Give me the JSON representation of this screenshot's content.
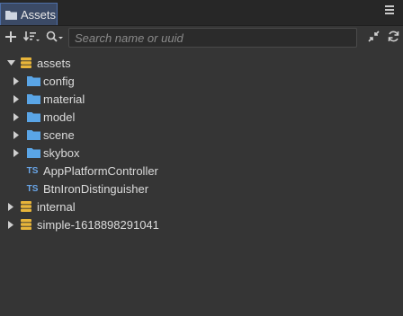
{
  "tab": {
    "title": "Assets",
    "icon": "folder-icon"
  },
  "toolbar": {
    "add_icon": "plus-icon",
    "sort_icon": "sort-icon",
    "search_filter_icon": "search-filter-icon",
    "search_placeholder": "Search name or uuid",
    "collapse_icon": "collapse-icon",
    "refresh_icon": "refresh-icon"
  },
  "tree": {
    "assets": {
      "label": "assets",
      "expanded": true
    },
    "config": {
      "label": "config"
    },
    "material": {
      "label": "material"
    },
    "model": {
      "label": "model"
    },
    "scene": {
      "label": "scene"
    },
    "skybox": {
      "label": "skybox"
    },
    "script1": {
      "label": "AppPlatformController",
      "badge": "TS"
    },
    "script2": {
      "label": "BtnIronDistinguisher",
      "badge": "TS"
    },
    "internal": {
      "label": "internal",
      "expanded": false
    },
    "simple": {
      "label": "simple-1618898291041",
      "expanded": false
    }
  },
  "colors": {
    "accent_tab": "#3b4a66",
    "folder_blue": "#5aa5e6",
    "db_yellow": "#e8b53a",
    "ts_blue": "#6aa7ea"
  }
}
